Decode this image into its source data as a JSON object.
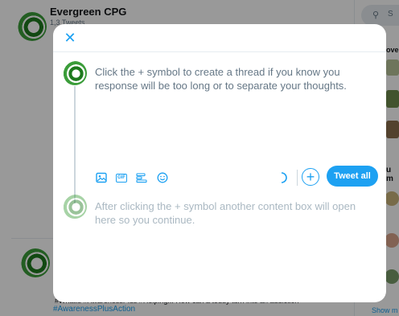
{
  "background": {
    "header": {
      "back_icon": "back-arrow-icon",
      "title": "Evergreen CPG",
      "subtitle": "1,3 Tweets"
    },
    "search": {
      "placeholder": "S"
    },
    "right_column": {
      "heading1": "ove",
      "heading2": "u m",
      "show_more": "Show m"
    },
    "tweet": {
      "text": "#WhatIs #AwarenessPlus #Helping... How can a teddy turn into an addiction",
      "hashtag": "#AwarenessPlusAction"
    }
  },
  "modal": {
    "close_icon": "close-icon",
    "compose_1": {
      "text": "Click the + symbol to create a thread if you know you response will be too long or to separate your thoughts."
    },
    "compose_2": {
      "text": "After clicking the + symbol another content box will open here so you continue."
    },
    "toolbar": {
      "icons": [
        "image-icon",
        "gif-icon",
        "poll-icon",
        "emoji-icon"
      ],
      "gif_label": "GIF",
      "tweet_all_label": "Tweet all",
      "add_label": "+"
    }
  },
  "colors": {
    "accent": "#1da1f2",
    "brand_green": "#3b9d3a"
  }
}
